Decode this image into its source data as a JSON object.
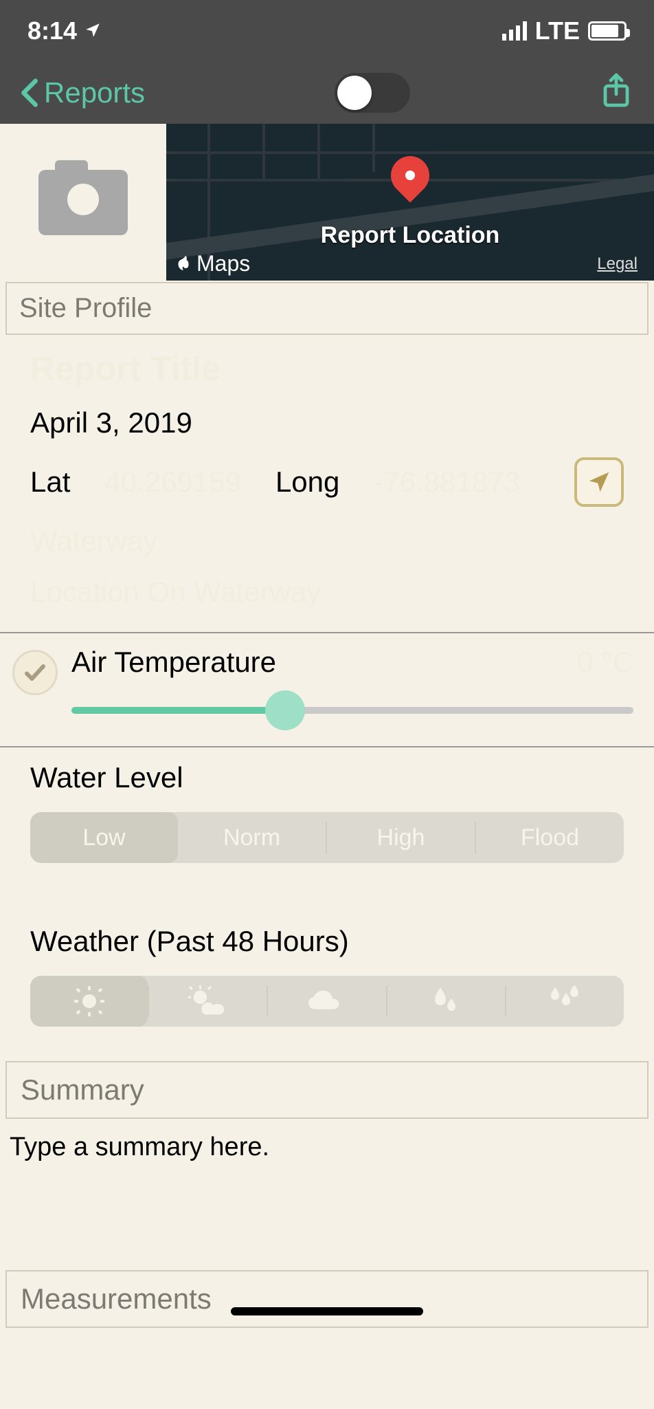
{
  "status": {
    "time": "8:14",
    "network": "LTE"
  },
  "nav": {
    "back_label": "Reports"
  },
  "map": {
    "title": "Report Location",
    "brand": "Maps",
    "legal": "Legal"
  },
  "site_profile": {
    "header": "Site Profile",
    "report_title_placeholder": "Report Title",
    "date": "April 3, 2019",
    "lat_label": "Lat",
    "long_label": "Long",
    "lat_value": "40.269159",
    "long_value": "-76.881873",
    "waterway_placeholder": "Waterway",
    "location_on_waterway_placeholder": "Location On Waterway"
  },
  "air_temp": {
    "label": "Air Temperature",
    "value_display": "0 °C",
    "slider_percent": 38
  },
  "water_level": {
    "label": "Water Level",
    "options": [
      "Low",
      "Norm",
      "High",
      "Flood"
    ],
    "selected_index": 0
  },
  "weather": {
    "label": "Weather (Past 48 Hours)",
    "options": [
      "sunny",
      "partly-cloudy",
      "cloudy",
      "rain",
      "heavy-rain"
    ],
    "selected_index": 0
  },
  "summary": {
    "header": "Summary",
    "placeholder": "Type a summary here."
  },
  "measurements": {
    "header": "Measurements"
  }
}
